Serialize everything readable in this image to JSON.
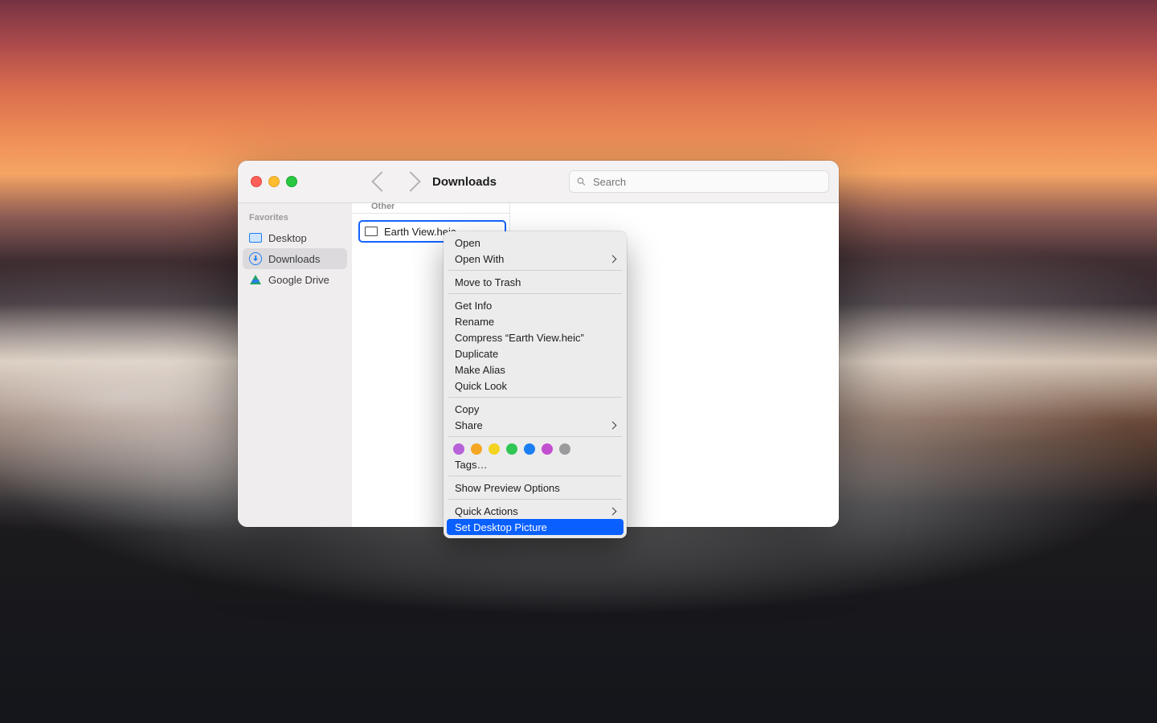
{
  "window": {
    "title": "Downloads"
  },
  "search": {
    "placeholder": "Search"
  },
  "sidebar": {
    "section": "Favorites",
    "items": [
      {
        "label": "Desktop",
        "icon": "desktop"
      },
      {
        "label": "Downloads",
        "icon": "download",
        "selected": true
      },
      {
        "label": "Google Drive",
        "icon": "gdrive"
      }
    ]
  },
  "column": {
    "group": "Other",
    "files": [
      {
        "name": "Earth View.heic",
        "selected": true
      }
    ]
  },
  "context_menu": {
    "items": [
      {
        "label": "Open"
      },
      {
        "label": "Open With",
        "submenu": true
      },
      {
        "sep": true
      },
      {
        "label": "Move to Trash"
      },
      {
        "sep": true
      },
      {
        "label": "Get Info"
      },
      {
        "label": "Rename"
      },
      {
        "label": "Compress “Earth View.heic”"
      },
      {
        "label": "Duplicate"
      },
      {
        "label": "Make Alias"
      },
      {
        "label": "Quick Look"
      },
      {
        "sep": true
      },
      {
        "label": "Copy"
      },
      {
        "label": "Share",
        "submenu": true
      },
      {
        "sep": true
      },
      {
        "tags": [
          "#b762d9",
          "#f5a623",
          "#f3d321",
          "#30c654",
          "#1b7ff3",
          "#c24fd0",
          "#9b9b9d"
        ]
      },
      {
        "label": "Tags…"
      },
      {
        "sep": true
      },
      {
        "label": "Show Preview Options"
      },
      {
        "sep": true
      },
      {
        "label": "Quick Actions",
        "submenu": true
      },
      {
        "label": "Set Desktop Picture",
        "selected": true
      }
    ]
  }
}
